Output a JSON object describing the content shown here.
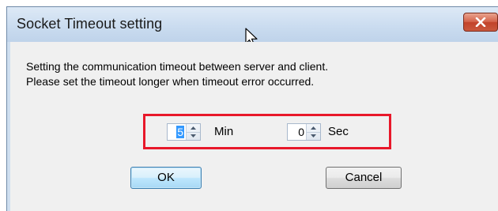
{
  "window": {
    "title": "Socket Timeout setting",
    "close_icon": "close-icon"
  },
  "description": {
    "line1": "Setting the communication timeout between server and client.",
    "line2": "Please set the timeout longer when timeout error occurred."
  },
  "timeout": {
    "minutes_value": "5",
    "minutes_unit": "Min",
    "seconds_value": "0",
    "seconds_unit": "Sec",
    "highlight_color": "#e8182a"
  },
  "buttons": {
    "ok_label": "OK",
    "cancel_label": "Cancel"
  },
  "icons": {
    "cursor": "mouse-pointer-icon",
    "spin_up": "spin-up-arrow-icon",
    "spin_down": "spin-down-arrow-icon"
  }
}
